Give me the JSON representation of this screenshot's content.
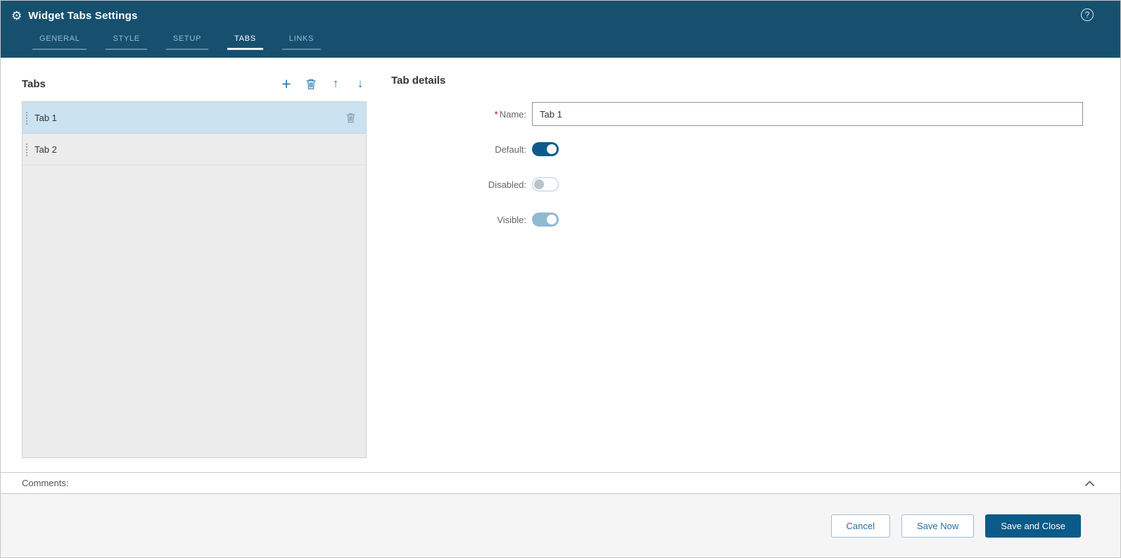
{
  "header": {
    "title": "Widget Tabs Settings",
    "nav": [
      {
        "label": "GENERAL",
        "active": false
      },
      {
        "label": "STYLE",
        "active": false
      },
      {
        "label": "SETUP",
        "active": false
      },
      {
        "label": "TABS",
        "active": true
      },
      {
        "label": "LINKS",
        "active": false
      }
    ]
  },
  "left_panel": {
    "title": "Tabs",
    "items": [
      {
        "label": "Tab 1",
        "selected": true
      },
      {
        "label": "Tab 2",
        "selected": false
      }
    ]
  },
  "details": {
    "title": "Tab details",
    "required_marker": "*",
    "name_label": "Name:",
    "name_value": "Tab 1",
    "toggles": [
      {
        "label": "Default:",
        "state": "on"
      },
      {
        "label": "Disabled:",
        "state": "off"
      },
      {
        "label": "Visible:",
        "state": "on-muted"
      }
    ]
  },
  "comments": {
    "label": "Comments:"
  },
  "footer": {
    "cancel_label": "Cancel",
    "save_now_label": "Save Now",
    "save_close_label": "Save and Close"
  },
  "icons": {
    "gear": "⚙",
    "help": "?",
    "plus": "+",
    "arrow_up": "↑",
    "arrow_down": "↓"
  },
  "colors": {
    "header_bg": "#17506f",
    "accent_blue": "#2279a9",
    "selected_row_bg": "#cbe2f1",
    "toggle_on": "#0b5c8d",
    "toggle_on_muted": "#92b9d4",
    "primary_button_bg": "#0b5a87",
    "required_red": "#c00200"
  }
}
